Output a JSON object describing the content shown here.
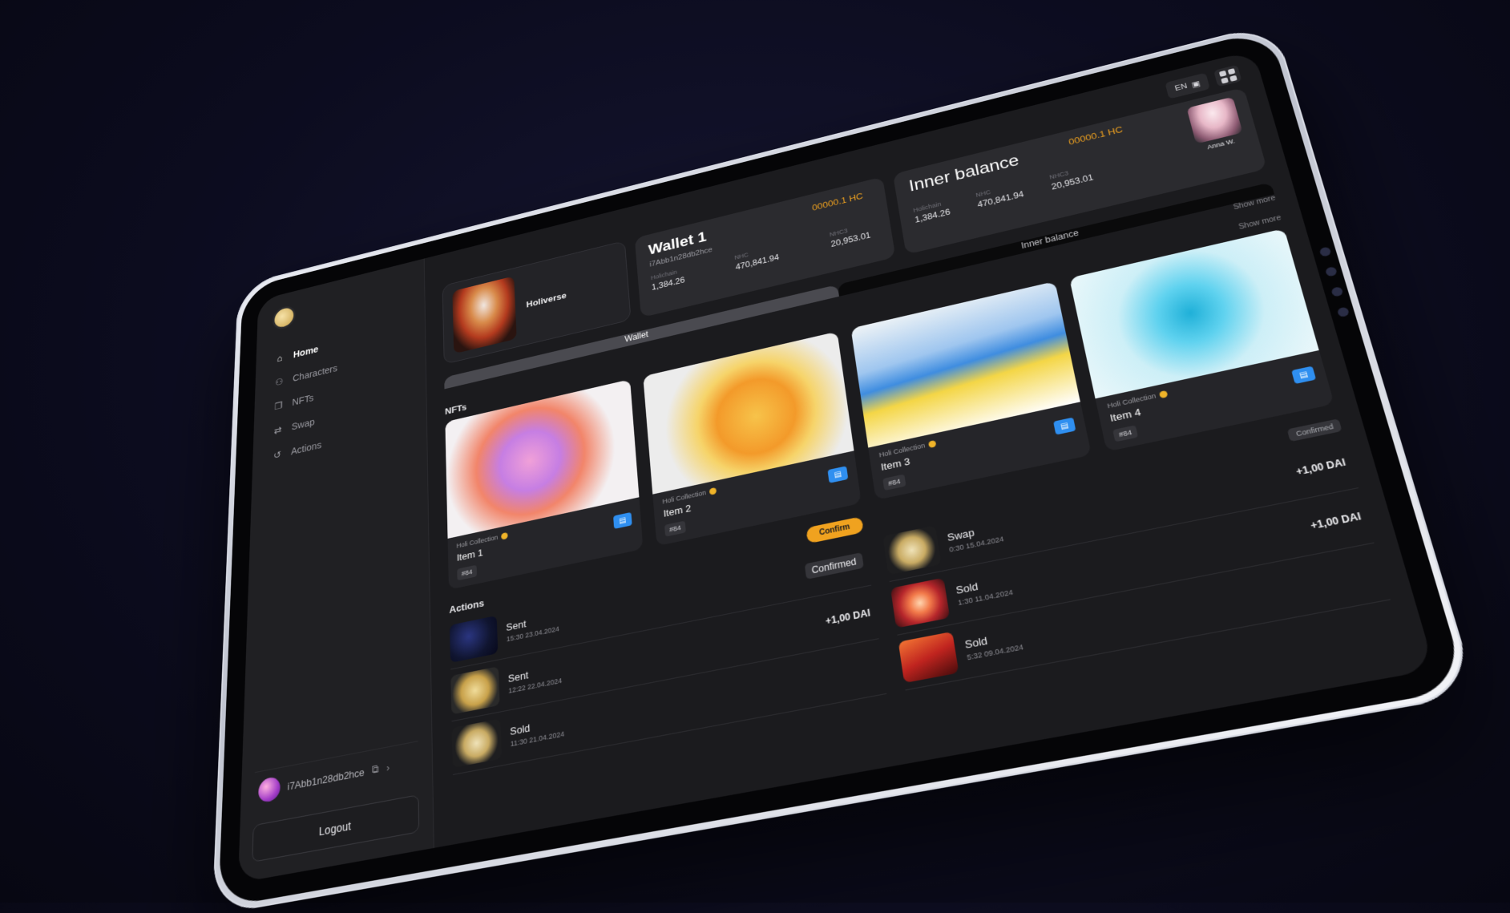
{
  "sidebar": {
    "nav": [
      {
        "label": "Home",
        "icon": "home-icon"
      },
      {
        "label": "Characters",
        "icon": "characters-icon"
      },
      {
        "label": "NFTs",
        "icon": "nfts-icon"
      },
      {
        "label": "Swap",
        "icon": "swap-icon"
      },
      {
        "label": "Actions",
        "icon": "history-icon"
      }
    ],
    "user_address": "i7Abb1n28db2hce",
    "logout_label": "Logout"
  },
  "topbar": {
    "language": "EN"
  },
  "profile": {
    "name": "Holiverse"
  },
  "wallet": {
    "title": "Wallet 1",
    "amount": "00000.1 HC",
    "address": "i7Abb1n28db2hce",
    "stats": [
      {
        "label": "Holichain",
        "value": "1,384.26"
      },
      {
        "label": "NHC",
        "value": "470,841.94"
      },
      {
        "label": "NHC3",
        "value": "20,953.01"
      }
    ]
  },
  "inner_balance": {
    "title": "Inner balance",
    "amount": "00000.1 HC",
    "stats": [
      {
        "label": "Holichain",
        "value": "1,384.26"
      },
      {
        "label": "NHC",
        "value": "470,841.94"
      },
      {
        "label": "NHC3",
        "value": "20,953.01"
      }
    ],
    "user_name": "Anna W."
  },
  "tabs": {
    "wallet": "Wallet",
    "inner": "Inner balance",
    "show_more": "Show more"
  },
  "nfts": {
    "title": "NFTs",
    "items": [
      {
        "collection": "Holi Collection",
        "name": "Item 1",
        "badge": "#84"
      },
      {
        "collection": "Holi Collection",
        "name": "Item 2",
        "badge": "#84"
      },
      {
        "collection": "Holi Collection",
        "name": "Item 3",
        "badge": "#84"
      },
      {
        "collection": "Holi Collection",
        "name": "Item 4",
        "badge": "#84"
      }
    ],
    "show_more": "Show more"
  },
  "actions": {
    "title": "Actions",
    "confirm_label": "Confirm",
    "confirmed_label": "Confirmed",
    "left": [
      {
        "title": "Sent",
        "time": "15:30 23.04.2024",
        "right": "Confirmed"
      },
      {
        "title": "Sent",
        "time": "12:22 22.04.2024",
        "right": "+1,00 DAI"
      },
      {
        "title": "Sold",
        "time": "11:30 21.04.2024",
        "right": ""
      }
    ],
    "right": [
      {
        "title": "Swap",
        "time": "0:30 15.04.2024",
        "right": "+1,00 DAI"
      },
      {
        "title": "Sold",
        "time": "1:30 11.04.2024",
        "right": "+1,00 DAI"
      },
      {
        "title": "Sold",
        "time": "5:32 09.04.2024",
        "right": ""
      }
    ]
  },
  "colors": {
    "accent": "#f0a21f",
    "nft_action": "#2f8ff0",
    "background": "#1b1b1e"
  }
}
